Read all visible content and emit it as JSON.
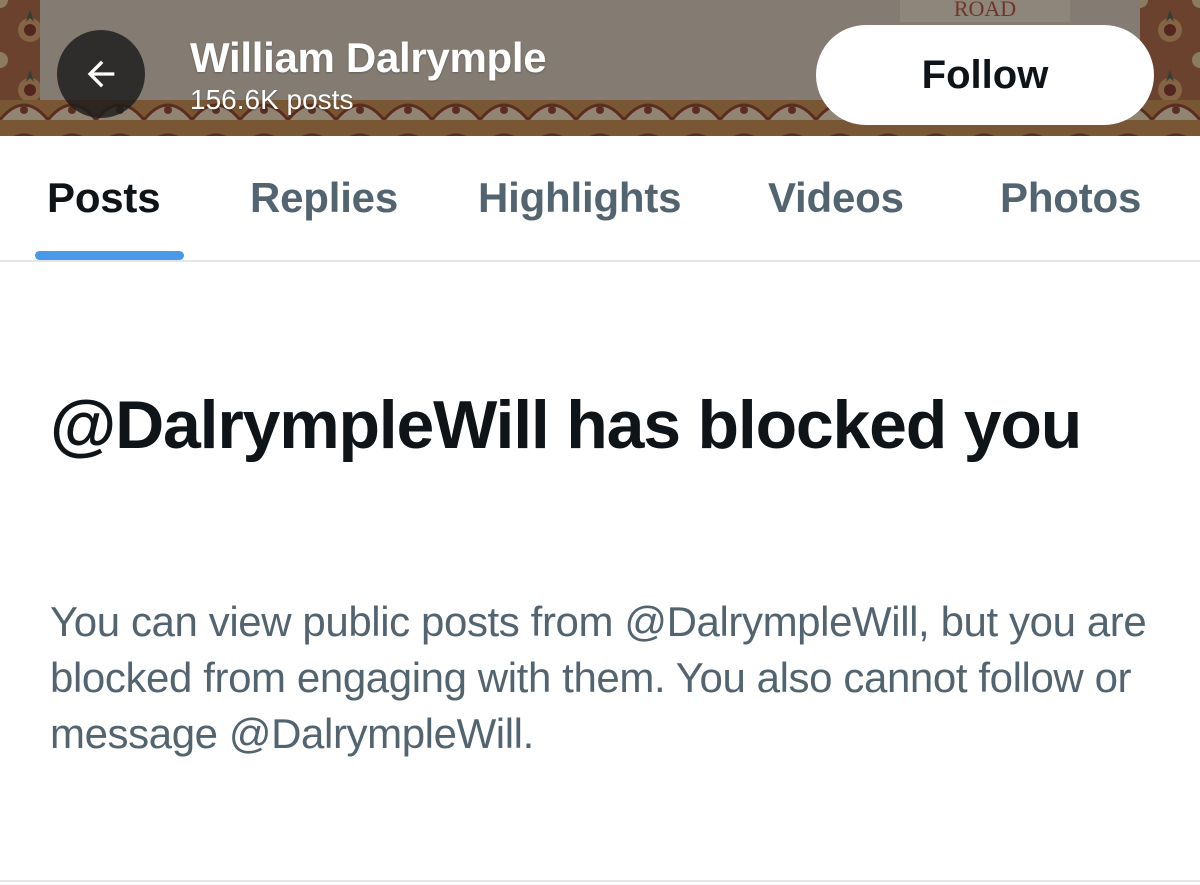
{
  "header": {
    "name": "William Dalrymple",
    "post_count": "156.6K posts",
    "follow_label": "Follow",
    "back_icon": "arrow-left-icon",
    "banner_text": "ROAD"
  },
  "tabs": [
    {
      "label": "Posts",
      "active": true
    },
    {
      "label": "Replies",
      "active": false
    },
    {
      "label": "Highlights",
      "active": false
    },
    {
      "label": "Videos",
      "active": false
    },
    {
      "label": "Photos",
      "active": false
    }
  ],
  "blocked": {
    "title": "@DalrympleWill has blocked you",
    "body": "You can view public posts from @DalrympleWill, but you are blocked from engaging with them. You also cannot follow or message @DalrympleWill."
  },
  "colors": {
    "accent": "#4a99e9",
    "primary_text": "#0f1419",
    "secondary_text": "#536471"
  }
}
